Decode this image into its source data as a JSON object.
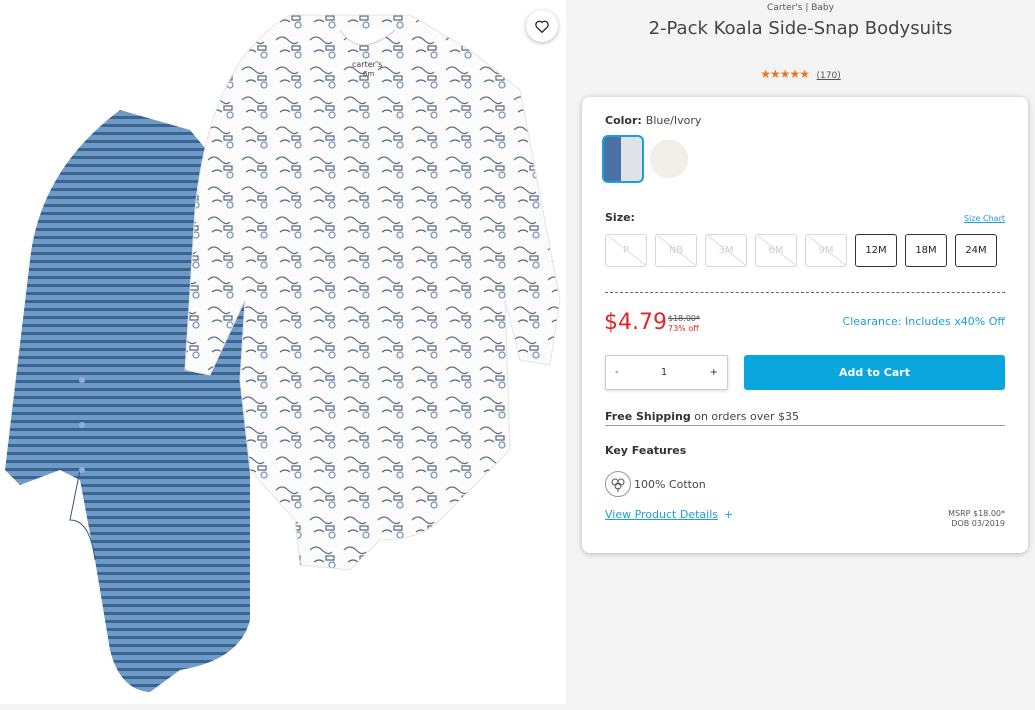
{
  "product": {
    "brand": "Carter's | Baby",
    "title": "2-Pack Koala Side-Snap Bodysuits",
    "rating_stars": "★★★★★",
    "review_count": "(170)"
  },
  "color": {
    "label": "Color:",
    "value": "Blue/Ivory"
  },
  "size": {
    "label": "Size:",
    "chart_link": "Size Chart",
    "options": [
      {
        "label": "P",
        "available": false
      },
      {
        "label": "NB",
        "available": false
      },
      {
        "label": "3M",
        "available": false
      },
      {
        "label": "6M",
        "available": false
      },
      {
        "label": "9M",
        "available": false
      },
      {
        "label": "12M",
        "available": true
      },
      {
        "label": "18M",
        "available": true
      },
      {
        "label": "24M",
        "available": true
      }
    ]
  },
  "pricing": {
    "price": "$4.79",
    "original": "$18.00*",
    "percent_off": "73% off",
    "clearance": "Clearance: Includes x40% Off"
  },
  "quantity": {
    "minus": "-",
    "value": "1",
    "plus": "+"
  },
  "add_to_cart": "Add to Cart",
  "shipping": {
    "bold": "Free Shipping",
    "rest": " on orders over $35"
  },
  "features": {
    "heading": "Key Features",
    "cotton": "100% Cotton"
  },
  "details": {
    "link": "View Product Details",
    "plus": "+",
    "msrp": "MSRP $18.00*",
    "dob": "DOB 03/2019"
  },
  "colors": {
    "accent": "#0ca6de",
    "price_red": "#e0262b",
    "star": "#e8781a"
  }
}
